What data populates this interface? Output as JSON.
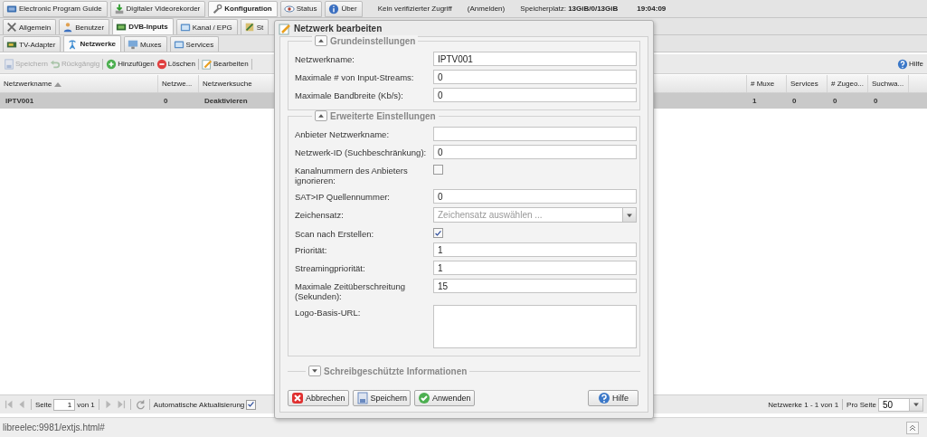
{
  "top_tabs": [
    {
      "label": "Electronic Program Guide",
      "selected": false
    },
    {
      "label": "Digitaler Videorekorder",
      "selected": false
    },
    {
      "label": "Konfiguration",
      "selected": true
    },
    {
      "label": "Status",
      "selected": false
    },
    {
      "label": "Über",
      "selected": false
    }
  ],
  "session": {
    "access": "Kein verifizierter Zugriff",
    "login": "(Anmelden)",
    "storage": "Speicherplatz: **13GiB/0/13GiB**",
    "time": "19:04:09"
  },
  "config_tabs": [
    {
      "label": "Allgemein",
      "selected": false
    },
    {
      "label": "Benutzer",
      "selected": false
    },
    {
      "label": "DVB-Inputs",
      "selected": true
    },
    {
      "label": "Kanal / EPG",
      "selected": false
    },
    {
      "label": "St",
      "selected": false
    }
  ],
  "dvb_tabs": [
    {
      "label": "TV-Adapter",
      "selected": false
    },
    {
      "label": "Netzwerke",
      "selected": true
    },
    {
      "label": "Muxes",
      "selected": false
    },
    {
      "label": "Services",
      "selected": false
    }
  ],
  "toolbar": {
    "groups": [
      [
        {
          "label": "Speichern",
          "disabled": true
        },
        {
          "label": "Rückgängig",
          "disabled": true
        }
      ],
      [
        {
          "label": "Hinzufügen",
          "disabled": false
        },
        {
          "label": "Löschen",
          "disabled": false
        }
      ],
      [
        {
          "label": "Bearbeiten",
          "disabled": false
        }
      ]
    ],
    "help": "Hilfe"
  },
  "table": {
    "columns": [
      {
        "label": "Netzwerkname",
        "sorted": true
      },
      {
        "label": "Netzwe..."
      },
      {
        "label": "Netzwerksuche"
      },
      {
        "label": "# Muxe"
      },
      {
        "label": "Services"
      },
      {
        "label": "# Zugeo..."
      },
      {
        "label": "Suchwa..."
      }
    ],
    "rows": [
      {
        "selected": true,
        "cells": [
          "IPTV001",
          "0",
          "Deaktivieren",
          "1",
          "0",
          "0",
          "0"
        ]
      }
    ]
  },
  "pager": {
    "page_label": "Seite",
    "page": "1",
    "page_count": "von 1",
    "auto_refresh_label": "Automatische Aktualisierung",
    "auto_refresh": true,
    "summary": "Netzwerke 1 - 1 von 1",
    "per_page_label": "Pro Seite",
    "per_page": "50"
  },
  "status_bar": {
    "url": "libreelec:9981/extjs.html#"
  },
  "dialog": {
    "title": "Netzwerk bearbeiten",
    "sections": [
      {
        "title": "Grundeinstellungen",
        "expanded": true,
        "fields": [
          {
            "kind": "text",
            "label": "Netzwerkname:",
            "value": "IPTV001"
          },
          {
            "kind": "text",
            "label": "Maximale # von Input-Streams:",
            "value": "0"
          },
          {
            "kind": "text",
            "label": "Maximale Bandbreite (Kb/s):",
            "value": "0"
          }
        ]
      },
      {
        "title": "Erweiterte Einstellungen",
        "expanded": true,
        "fields": [
          {
            "kind": "text",
            "label": "Anbieter Netzwerkname:"
          },
          {
            "kind": "text",
            "label": "Netzwerk-ID (Suchbeschränkung):",
            "value": "0"
          },
          {
            "kind": "checkbox",
            "label": "Kanalnummern des Anbieters ignorieren:",
            "checked": false
          },
          {
            "kind": "text",
            "label": "SAT>IP Quellennummer:",
            "value": "0"
          },
          {
            "kind": "select",
            "label": "Zeichensatz:",
            "placeholder": "Zeichensatz auswählen ..."
          },
          {
            "kind": "checkbox",
            "label": "Scan nach Erstellen:",
            "checked": true
          },
          {
            "kind": "text",
            "label": "Priorität:",
            "value": "1"
          },
          {
            "kind": "text",
            "label": "Streamingpriorität:",
            "value": "1"
          },
          {
            "kind": "text",
            "label": "Maximale Zeitüberschreitung (Sekunden):",
            "value": "15"
          },
          {
            "kind": "textarea",
            "label": "Logo-Basis-URL:"
          }
        ]
      },
      {
        "title": "Schreibgeschützte Informationen",
        "expanded": false
      }
    ],
    "buttons": [
      {
        "label": "Abbrechen"
      },
      {
        "label": "Speichern"
      },
      {
        "label": "Anwenden"
      }
    ],
    "help": "Hilfe"
  }
}
